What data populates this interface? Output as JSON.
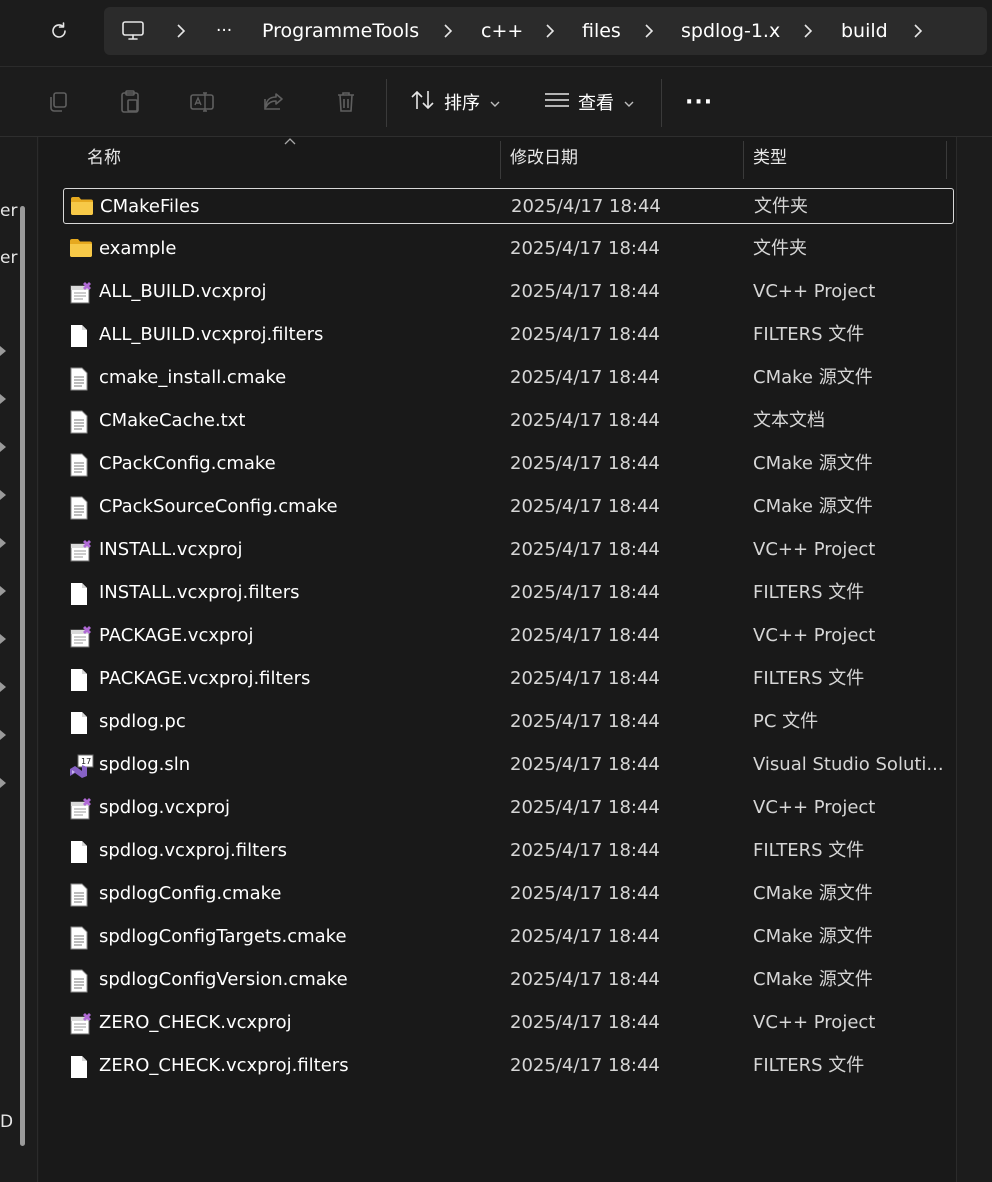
{
  "address_bar": {
    "crumbs": [
      "ProgrammeTools",
      "c++",
      "files",
      "spdlog-1.x",
      "build"
    ],
    "more": "···"
  },
  "command_bar": {
    "sort_label": "排序",
    "view_label": "查看",
    "more_label": "···"
  },
  "nav_fragments": [
    "er",
    "er",
    "D"
  ],
  "columns": {
    "name": "名称",
    "date": "修改日期",
    "type": "类型"
  },
  "files": [
    {
      "name": "CMakeFiles",
      "date": "2025/4/17 18:44",
      "type": "文件夹",
      "icon": "folder-icon"
    },
    {
      "name": "example",
      "date": "2025/4/17 18:44",
      "type": "文件夹",
      "icon": "folder-icon"
    },
    {
      "name": "ALL_BUILD.vcxproj",
      "date": "2025/4/17 18:44",
      "type": "VC++ Project",
      "icon": "vcxproj-icon"
    },
    {
      "name": "ALL_BUILD.vcxproj.filters",
      "date": "2025/4/17 18:44",
      "type": "FILTERS 文件",
      "icon": "file-icon"
    },
    {
      "name": "cmake_install.cmake",
      "date": "2025/4/17 18:44",
      "type": "CMake 源文件",
      "icon": "text-file-icon"
    },
    {
      "name": "CMakeCache.txt",
      "date": "2025/4/17 18:44",
      "type": "文本文档",
      "icon": "text-file-icon"
    },
    {
      "name": "CPackConfig.cmake",
      "date": "2025/4/17 18:44",
      "type": "CMake 源文件",
      "icon": "text-file-icon"
    },
    {
      "name": "CPackSourceConfig.cmake",
      "date": "2025/4/17 18:44",
      "type": "CMake 源文件",
      "icon": "text-file-icon"
    },
    {
      "name": "INSTALL.vcxproj",
      "date": "2025/4/17 18:44",
      "type": "VC++ Project",
      "icon": "vcxproj-icon"
    },
    {
      "name": "INSTALL.vcxproj.filters",
      "date": "2025/4/17 18:44",
      "type": "FILTERS 文件",
      "icon": "file-icon"
    },
    {
      "name": "PACKAGE.vcxproj",
      "date": "2025/4/17 18:44",
      "type": "VC++ Project",
      "icon": "vcxproj-icon"
    },
    {
      "name": "PACKAGE.vcxproj.filters",
      "date": "2025/4/17 18:44",
      "type": "FILTERS 文件",
      "icon": "file-icon"
    },
    {
      "name": "spdlog.pc",
      "date": "2025/4/17 18:44",
      "type": "PC 文件",
      "icon": "file-icon"
    },
    {
      "name": "spdlog.sln",
      "date": "2025/4/17 18:44",
      "type": "Visual Studio Soluti...",
      "icon": "sln-icon",
      "badge": "17"
    },
    {
      "name": "spdlog.vcxproj",
      "date": "2025/4/17 18:44",
      "type": "VC++ Project",
      "icon": "vcxproj-icon"
    },
    {
      "name": "spdlog.vcxproj.filters",
      "date": "2025/4/17 18:44",
      "type": "FILTERS 文件",
      "icon": "file-icon"
    },
    {
      "name": "spdlogConfig.cmake",
      "date": "2025/4/17 18:44",
      "type": "CMake 源文件",
      "icon": "text-file-icon"
    },
    {
      "name": "spdlogConfigTargets.cmake",
      "date": "2025/4/17 18:44",
      "type": "CMake 源文件",
      "icon": "text-file-icon"
    },
    {
      "name": "spdlogConfigVersion.cmake",
      "date": "2025/4/17 18:44",
      "type": "CMake 源文件",
      "icon": "text-file-icon"
    },
    {
      "name": "ZERO_CHECK.vcxproj",
      "date": "2025/4/17 18:44",
      "type": "VC++ Project",
      "icon": "vcxproj-icon"
    },
    {
      "name": "ZERO_CHECK.vcxproj.filters",
      "date": "2025/4/17 18:44",
      "type": "FILTERS 文件",
      "icon": "file-icon"
    }
  ],
  "selected_index": 0,
  "colors": {
    "background": "#191919",
    "folder": "#f5c243",
    "selection_border": "#d8d8d8",
    "vs_purple": "#8661c5"
  }
}
